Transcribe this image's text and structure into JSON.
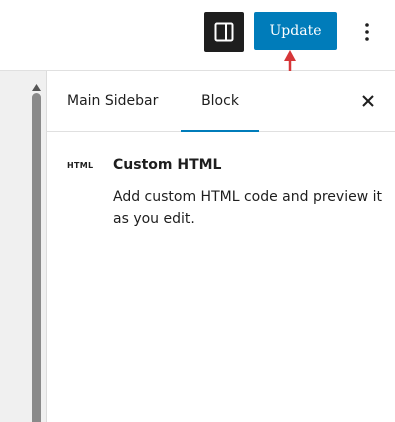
{
  "toolbar": {
    "settings_toggle_icon": "sidebar-panel-icon",
    "update_label": "Update",
    "options_icon": "vertical-ellipsis-icon"
  },
  "colors": {
    "accent": "#007cba",
    "toggle_bg": "#1e1e1e",
    "annotation": "#d63638"
  },
  "sidebar": {
    "tabs": [
      {
        "label": "Main Sidebar",
        "active": false
      },
      {
        "label": "Block",
        "active": true
      }
    ],
    "close_icon": "close-icon",
    "block": {
      "icon_text": "HTML",
      "title": "Custom HTML",
      "description": "Add custom HTML code and preview it as you edit."
    }
  }
}
